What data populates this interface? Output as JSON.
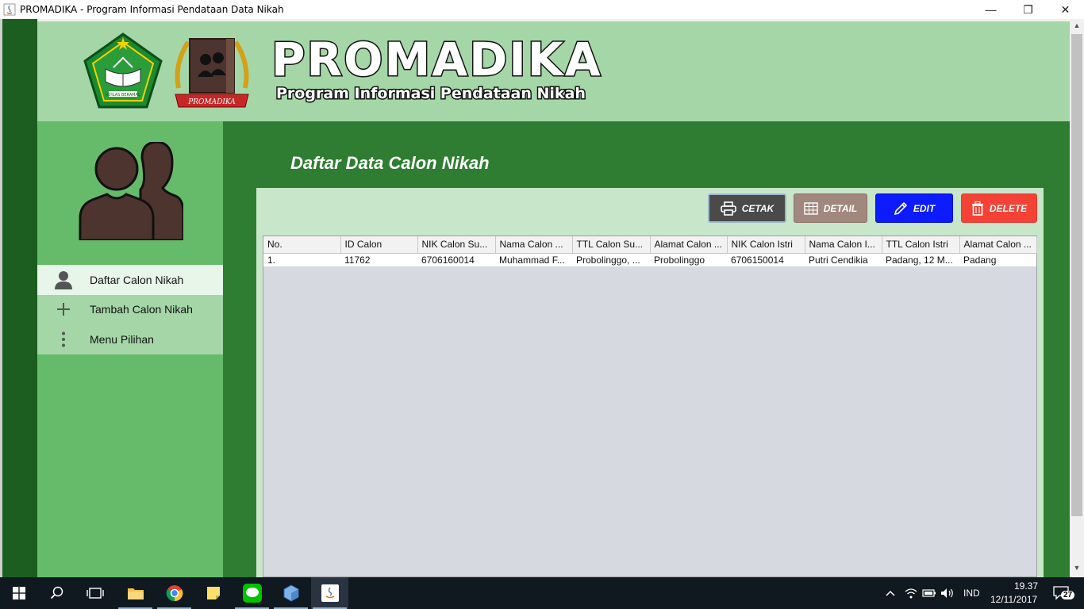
{
  "window": {
    "title": "PROMADIKA - Program Informasi Pendataan Data Nikah",
    "minimize": "—",
    "maximize": "❐",
    "close": "✕"
  },
  "header": {
    "brand": "PROMADIKA",
    "subtitle": "Program Informasi Pendataan Nikah",
    "logo_banner_text": "PROMADIKA",
    "kemenag_text": "IKHLAS BERAMAL"
  },
  "sidebar": {
    "items": [
      {
        "label": "Daftar Calon Nikah",
        "icon": "person-icon",
        "active": true
      },
      {
        "label": "Tambah Calon Nikah",
        "icon": "plus-icon",
        "active": false
      },
      {
        "label": "Menu Pilihan",
        "icon": "more-vertical-icon",
        "active": false
      }
    ]
  },
  "main": {
    "title": "Daftar Data Calon Nikah",
    "buttons": {
      "cetak": "CETAK",
      "detail": "DETAIL",
      "edit": "EDIT",
      "delete": "DELETE"
    },
    "table": {
      "columns": [
        "No.",
        "ID Calon",
        "NIK Calon Su...",
        "Nama Calon ...",
        "TTL Calon Su...",
        "Alamat Calon ...",
        "NIK Calon Istri",
        "Nama Calon I...",
        "TTL Calon Istri",
        "Alamat Calon ..."
      ],
      "rows": [
        [
          "1.",
          "11762",
          "6706160014",
          "Muhammad F...",
          "Probolinggo, ...",
          "Probolinggo",
          "6706150014",
          "Putri Cendikia",
          "Padang, 12 M...",
          "Padang"
        ]
      ]
    }
  },
  "taskbar": {
    "language": "IND",
    "time": "19.37",
    "date": "12/11/2017",
    "notifications": "27"
  },
  "colors": {
    "dark_green": "#1b5e20",
    "green": "#2e7d32",
    "light_green": "#a5d6a7",
    "sidebar_green": "#66bb6a",
    "cetak": "#4a4a4a",
    "detail": "#a1887f",
    "edit": "#0d1bff",
    "delete": "#f44336"
  }
}
